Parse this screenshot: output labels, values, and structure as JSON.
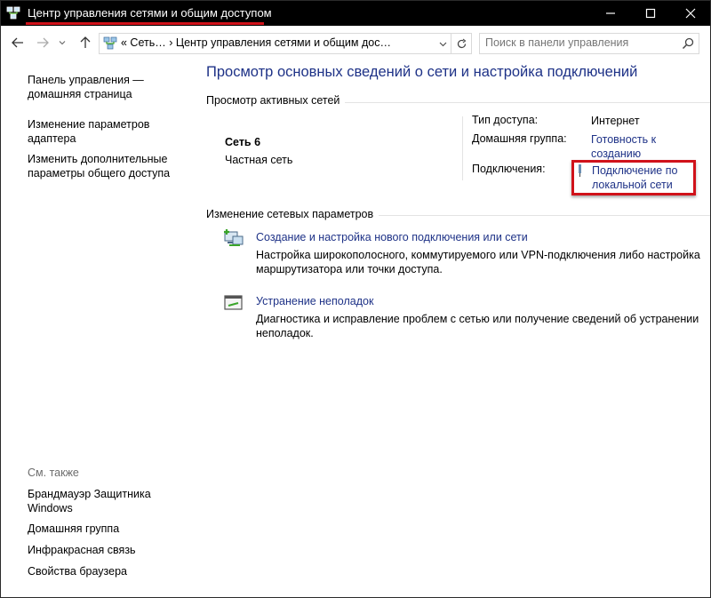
{
  "window": {
    "title": "Центр управления сетями и общим доступом",
    "icon": "network-center-icon",
    "accent": "#d0121a"
  },
  "address": {
    "breadcrumb": "«  Сеть…  ›  Центр управления сетями и общим дос…",
    "search_placeholder": "Поиск в панели управления"
  },
  "left": {
    "links": [
      "Панель управления — домашняя страница",
      "Изменение параметров адаптера",
      "Изменить дополнительные параметры общего доступа"
    ],
    "see_also_title": "См. также",
    "see_also": [
      "Брандмауэр Защитника Windows",
      "Домашняя группа",
      "Инфракрасная связь",
      "Свойства браузера"
    ]
  },
  "main": {
    "heading": "Просмотр основных сведений о сети и настройка подключений",
    "active_networks_title": "Просмотр активных сетей",
    "network": {
      "name": "Сеть  6",
      "type": "Частная сеть"
    },
    "props": {
      "access_type_label": "Тип доступа:",
      "access_type_value": "Интернет",
      "homegroup_label": "Домашняя группа:",
      "homegroup_value": "Готовность к созданию",
      "connections_label": "Подключения:",
      "connections_value": "Подключение по локальной сети"
    },
    "change_title": "Изменение сетевых параметров",
    "tasks": [
      {
        "link": "Создание и настройка нового подключения или сети",
        "desc": "Настройка широкополосного, коммутируемого или VPN-подключения либо настройка маршрутизатора или точки доступа.",
        "icon": "new-connection-icon"
      },
      {
        "link": "Устранение неполадок",
        "desc": "Диагностика и исправление проблем с сетью или получение сведений об устранении неполадок.",
        "icon": "troubleshoot-icon"
      }
    ]
  }
}
